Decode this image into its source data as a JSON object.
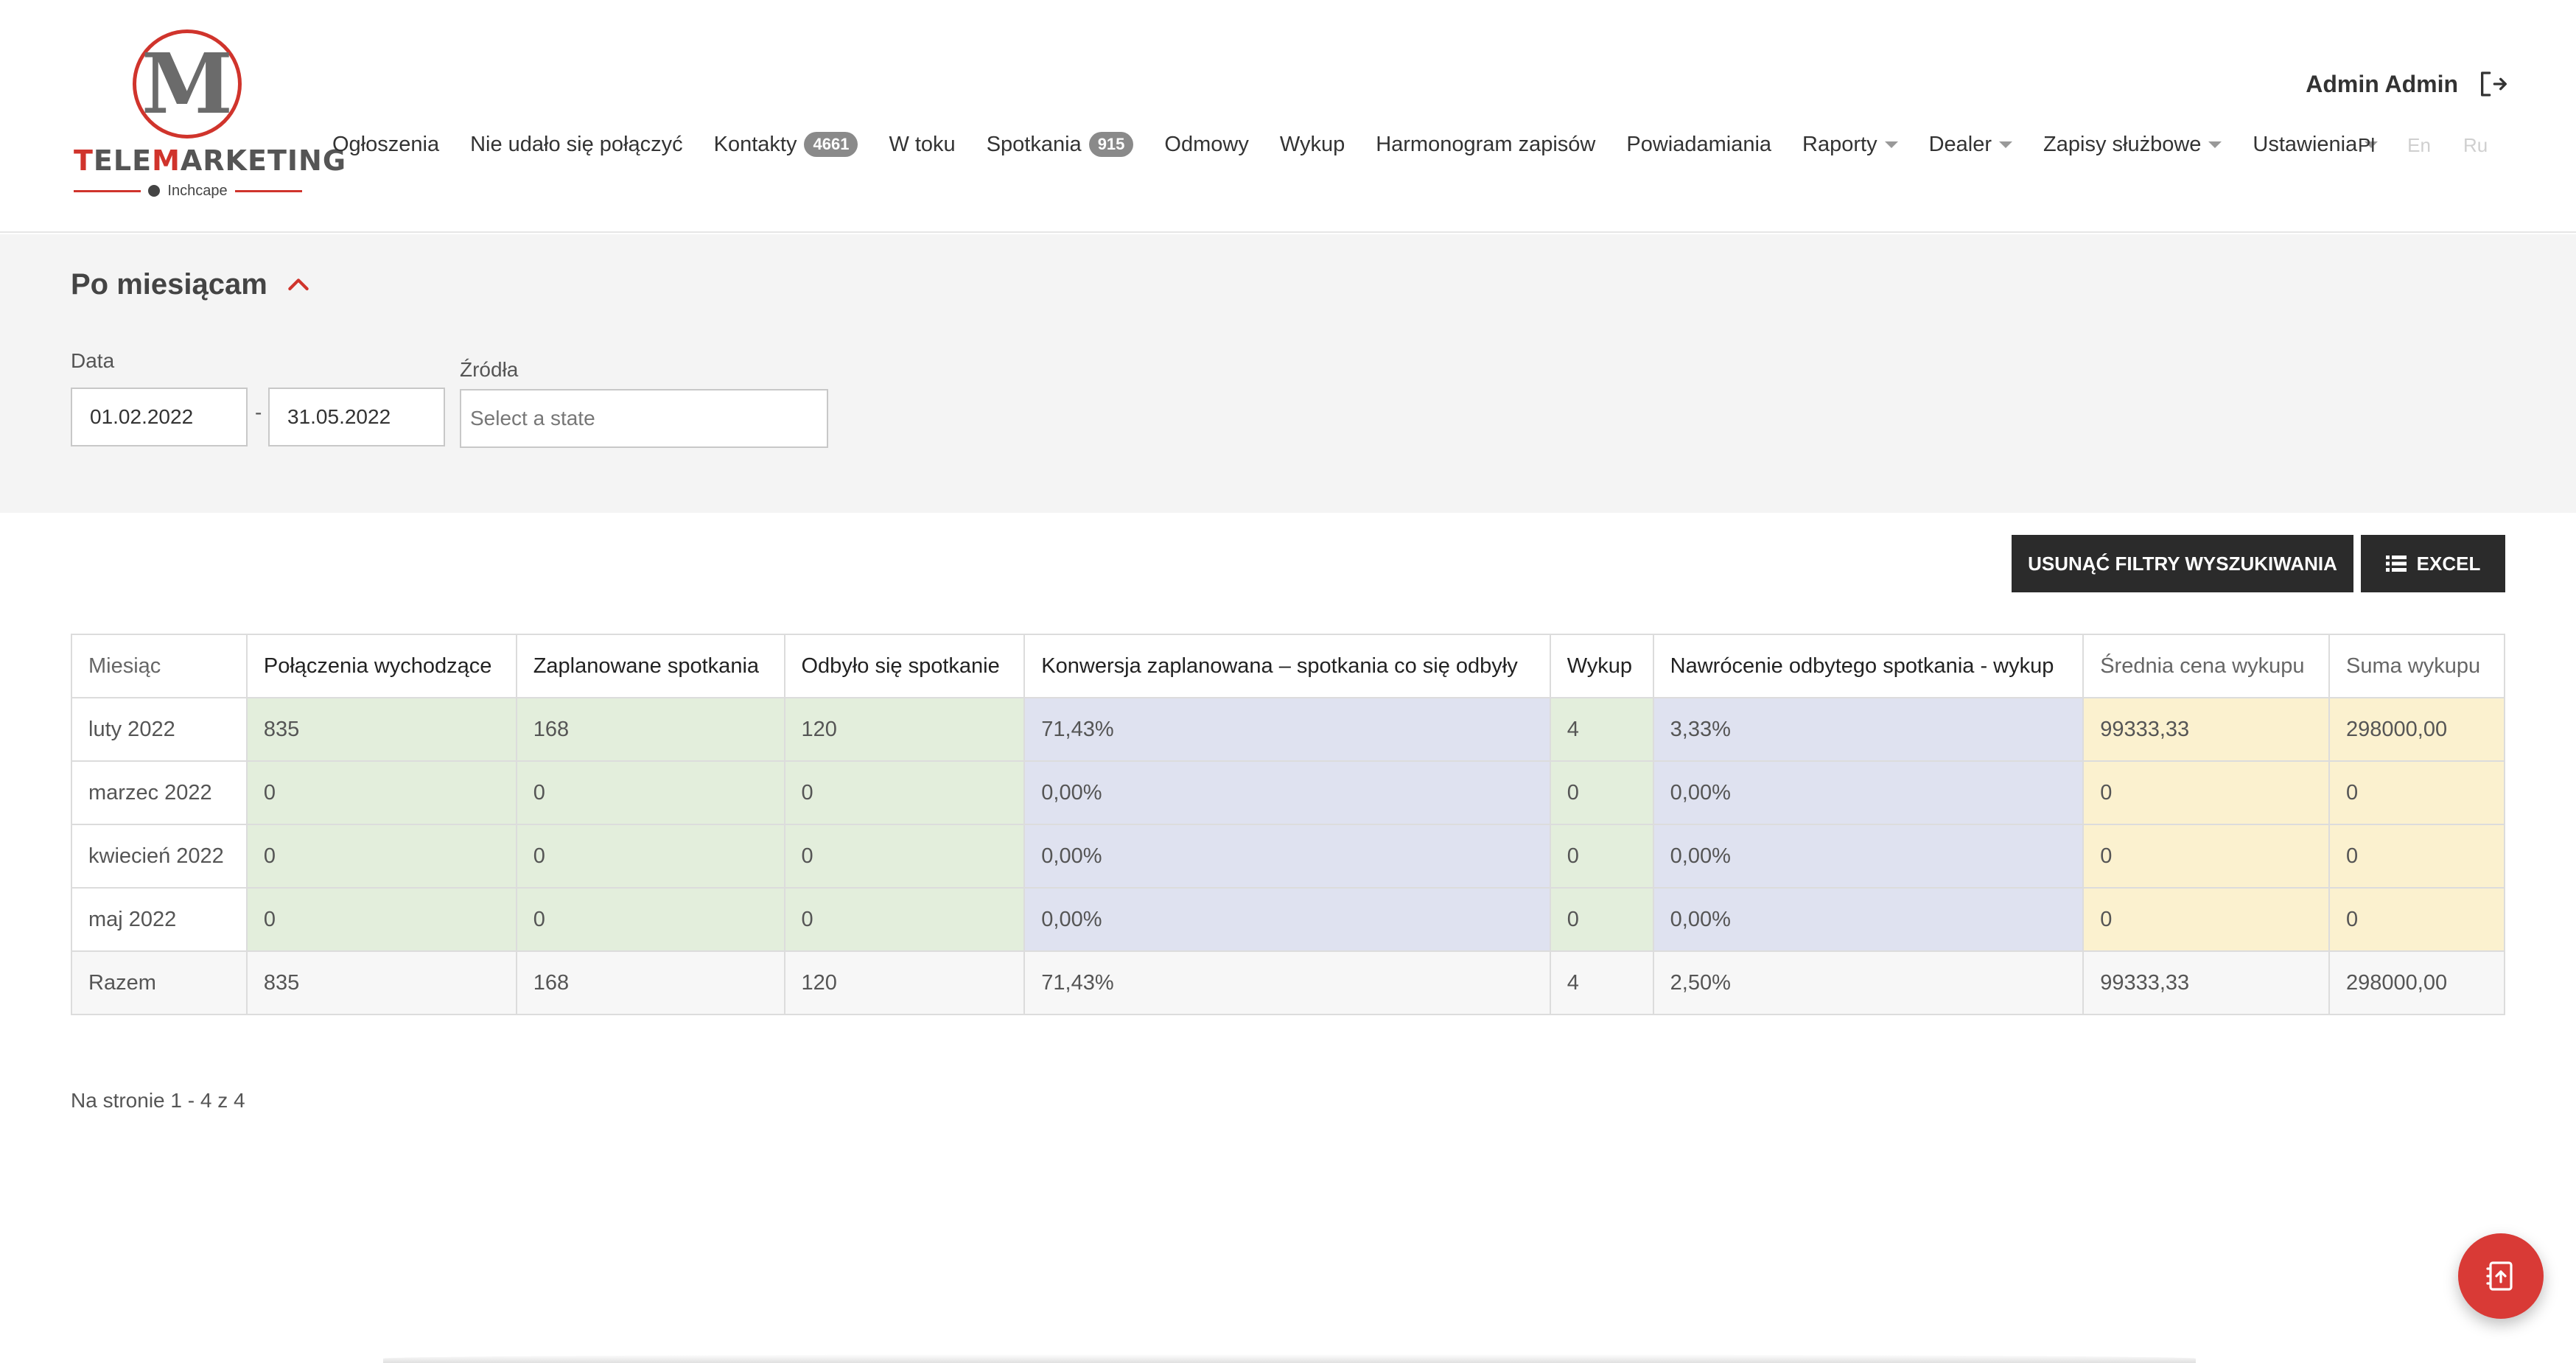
{
  "brand": {
    "logo_letter": "M",
    "name_red": "T",
    "name_mid": "ELE",
    "name_red2": "M",
    "name_rest": "ARKETING",
    "sub": "Inchcape",
    "accent_color": "#d0342c"
  },
  "nav": {
    "items": [
      {
        "label": "Ogłoszenia"
      },
      {
        "label": "Nie udało się połączyć"
      },
      {
        "label": "Kontakty",
        "badge": "4661"
      },
      {
        "label": "W toku"
      },
      {
        "label": "Spotkania",
        "badge": "915"
      },
      {
        "label": "Odmowy"
      },
      {
        "label": "Wykup"
      },
      {
        "label": "Harmonogram zapisów"
      },
      {
        "label": "Powiadamiania"
      },
      {
        "label": "Raporty"
      },
      {
        "label": "Dealer"
      },
      {
        "label": "Zapisy służbowe"
      },
      {
        "label": "Ustawienia"
      }
    ]
  },
  "user": {
    "name": "Admin Admin",
    "logout_icon": "logout-icon"
  },
  "langs": [
    "Pl",
    "En",
    "Ru"
  ],
  "filters": {
    "title": "Po miesiącam",
    "date_label": "Data",
    "date_from": "01.02.2022",
    "date_sep": "-",
    "date_to": "31.05.2022",
    "sources_label": "Źródła",
    "sources_placeholder": "Select a state"
  },
  "buttons": {
    "clear_filters": "USUNĄĆ FILTRY WYSZUKIWANIA",
    "excel": "EXCEL"
  },
  "table": {
    "headers": [
      "Miesiąc",
      "Połączenia wychodzące",
      "Zaplanowane spotkania",
      "Odbyło się spotkanie",
      "Konwersja zaplanowana – spotkania co się odbyły",
      "Wykup",
      "Nawrócenie odbytego spotkania - wykup",
      "Średnia cena wykupu",
      "Suma wykupu"
    ],
    "rows": [
      [
        "luty 2022",
        "835",
        "168",
        "120",
        "71,43%",
        "4",
        "3,33%",
        "99333,33",
        "298000,00"
      ],
      [
        "marzec 2022",
        "0",
        "0",
        "0",
        "0,00%",
        "0",
        "0,00%",
        "0",
        "0"
      ],
      [
        "kwiecień 2022",
        "0",
        "0",
        "0",
        "0,00%",
        "0",
        "0,00%",
        "0",
        "0"
      ],
      [
        "maj 2022",
        "0",
        "0",
        "0",
        "0,00%",
        "0",
        "0,00%",
        "0",
        "0"
      ]
    ],
    "total": [
      "Razem",
      "835",
      "168",
      "120",
      "71,43%",
      "4",
      "2,50%",
      "99333,33",
      "298000,00"
    ]
  },
  "pager": "Na stronie 1 - 4 z 4",
  "colors": {
    "green_cell": "#e3eedc",
    "blue_cell": "#dfe2f0",
    "yellow_cell": "#fbf1cf",
    "fab": "#d93a36"
  }
}
